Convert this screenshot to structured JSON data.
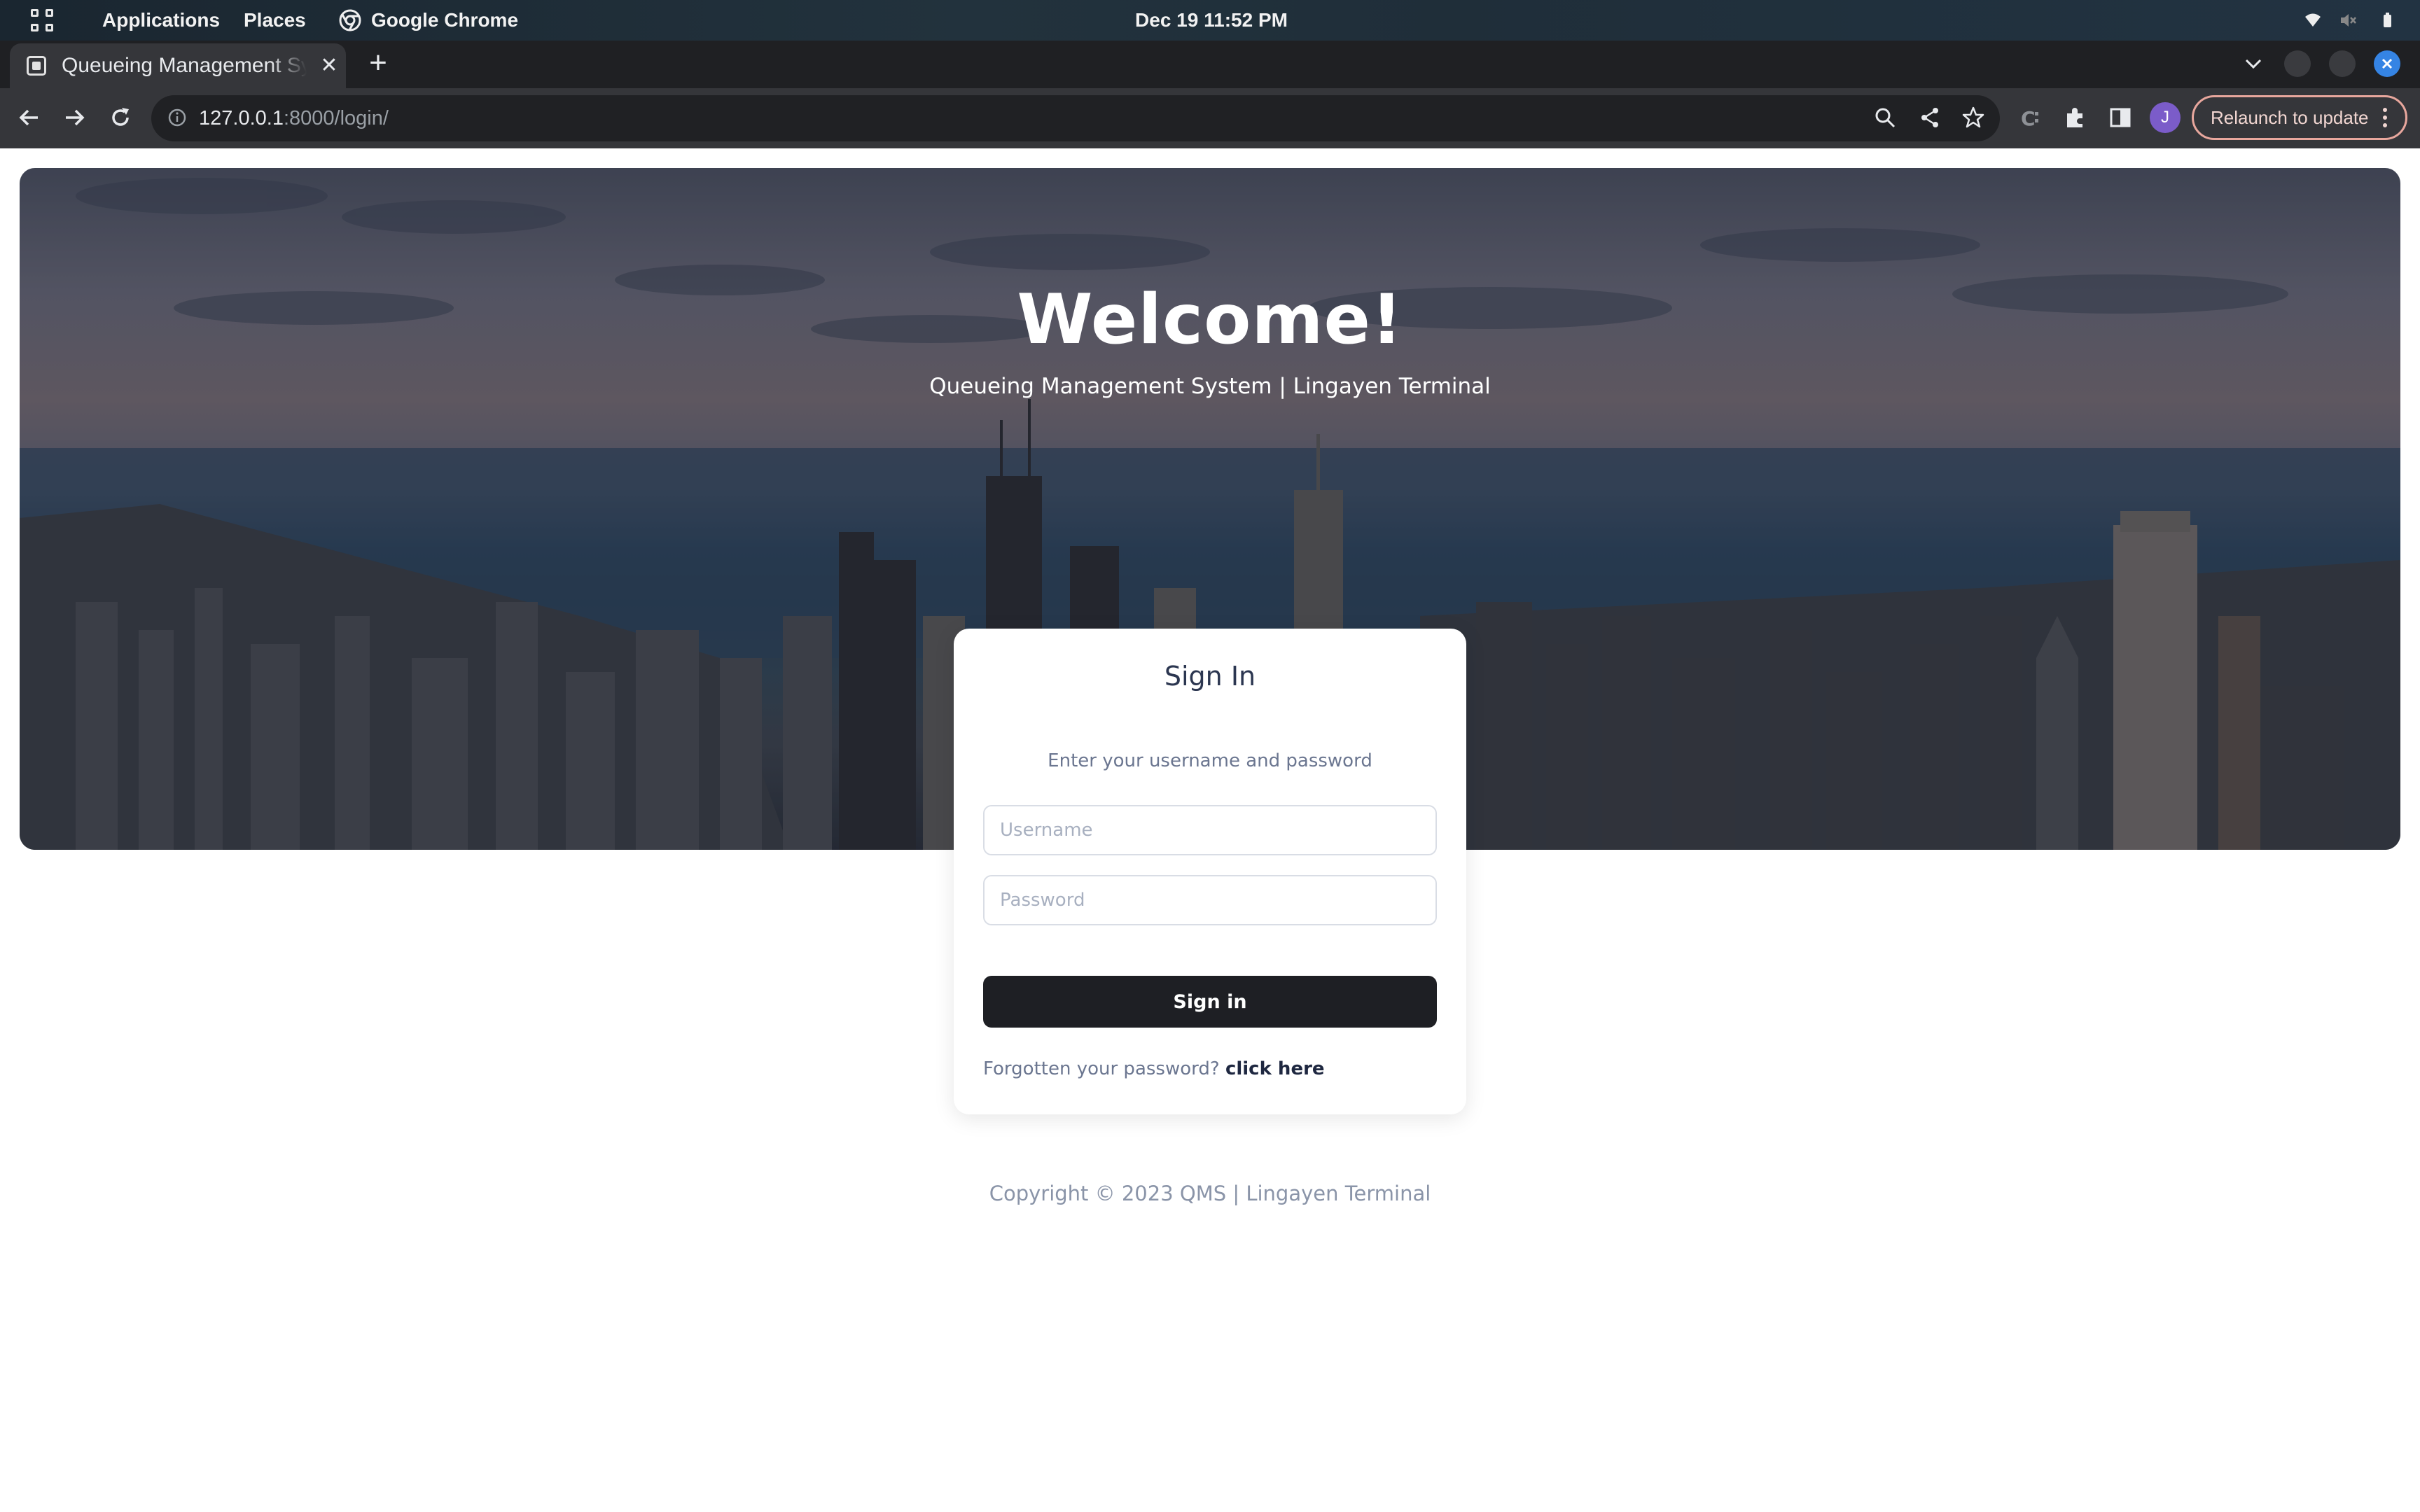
{
  "topbar": {
    "applications": "Applications",
    "places": "Places",
    "app_name": "Google Chrome",
    "clock": "Dec 19  11:52 PM"
  },
  "browser": {
    "tab_title": "Queueing Management System",
    "url_host": "127.0.0.1",
    "url_rest": ":8000/login/",
    "profile_initial": "J",
    "relaunch_label": "Relaunch to update"
  },
  "hero": {
    "title": "Welcome!",
    "subtitle": "Queueing Management System | Lingayen Terminal"
  },
  "login": {
    "title": "Sign In",
    "hint": "Enter your username and password",
    "username_placeholder": "Username",
    "password_placeholder": "Password",
    "submit_label": "Sign in",
    "forgot_text": "Forgotten your password?",
    "forgot_link": "click here"
  },
  "footer": {
    "copyright": "Copyright © 2023 QMS | Lingayen Terminal"
  },
  "colors": {
    "accent_dark": "#1e1f24",
    "relaunch_border": "#e8a79d",
    "window_close": "#3584e4",
    "avatar": "#7b5cc9"
  }
}
